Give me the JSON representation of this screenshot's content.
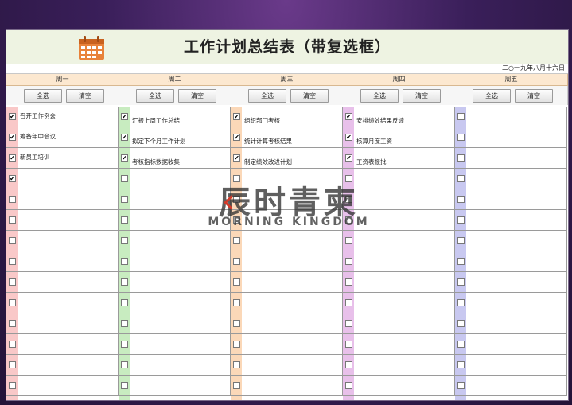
{
  "title": "工作计划总结表（带复选框）",
  "date": "二○一九年八月十六日",
  "buttons": {
    "select_all": "全选",
    "clear": "清空"
  },
  "watermark": {
    "cn": "辰时青柬",
    "en": "MORNING KINGDOM"
  },
  "colors": {
    "mon": "#f9c8c8",
    "tue": "#c8ecc0",
    "wed": "#fbd8b8",
    "thu": "#e8c0ea",
    "fri": "#c8c8f0",
    "accent": "#e8823a"
  },
  "days": [
    {
      "label": "周一",
      "tasks": [
        {
          "text": "召开工作例会",
          "checked": true
        },
        {
          "text": "筹备年中会议",
          "checked": true
        },
        {
          "text": "新员工培训",
          "checked": true
        },
        {
          "text": "",
          "checked": true
        }
      ]
    },
    {
      "label": "周二",
      "tasks": [
        {
          "text": "汇报上周工作总结",
          "checked": true
        },
        {
          "text": "拟定下个月工作计划",
          "checked": true
        },
        {
          "text": "考核指标数据收集",
          "checked": true
        }
      ]
    },
    {
      "label": "周三",
      "tasks": [
        {
          "text": "组织部门考核",
          "checked": true
        },
        {
          "text": "统计计算考核结果",
          "checked": true
        },
        {
          "text": "制定绩效改进计划",
          "checked": true
        }
      ]
    },
    {
      "label": "周四",
      "tasks": [
        {
          "text": "安排绩效结果反馈",
          "checked": true
        },
        {
          "text": "核算月度工资",
          "checked": true
        },
        {
          "text": "工资表报批",
          "checked": true
        }
      ]
    },
    {
      "label": "周五",
      "tasks": []
    }
  ]
}
